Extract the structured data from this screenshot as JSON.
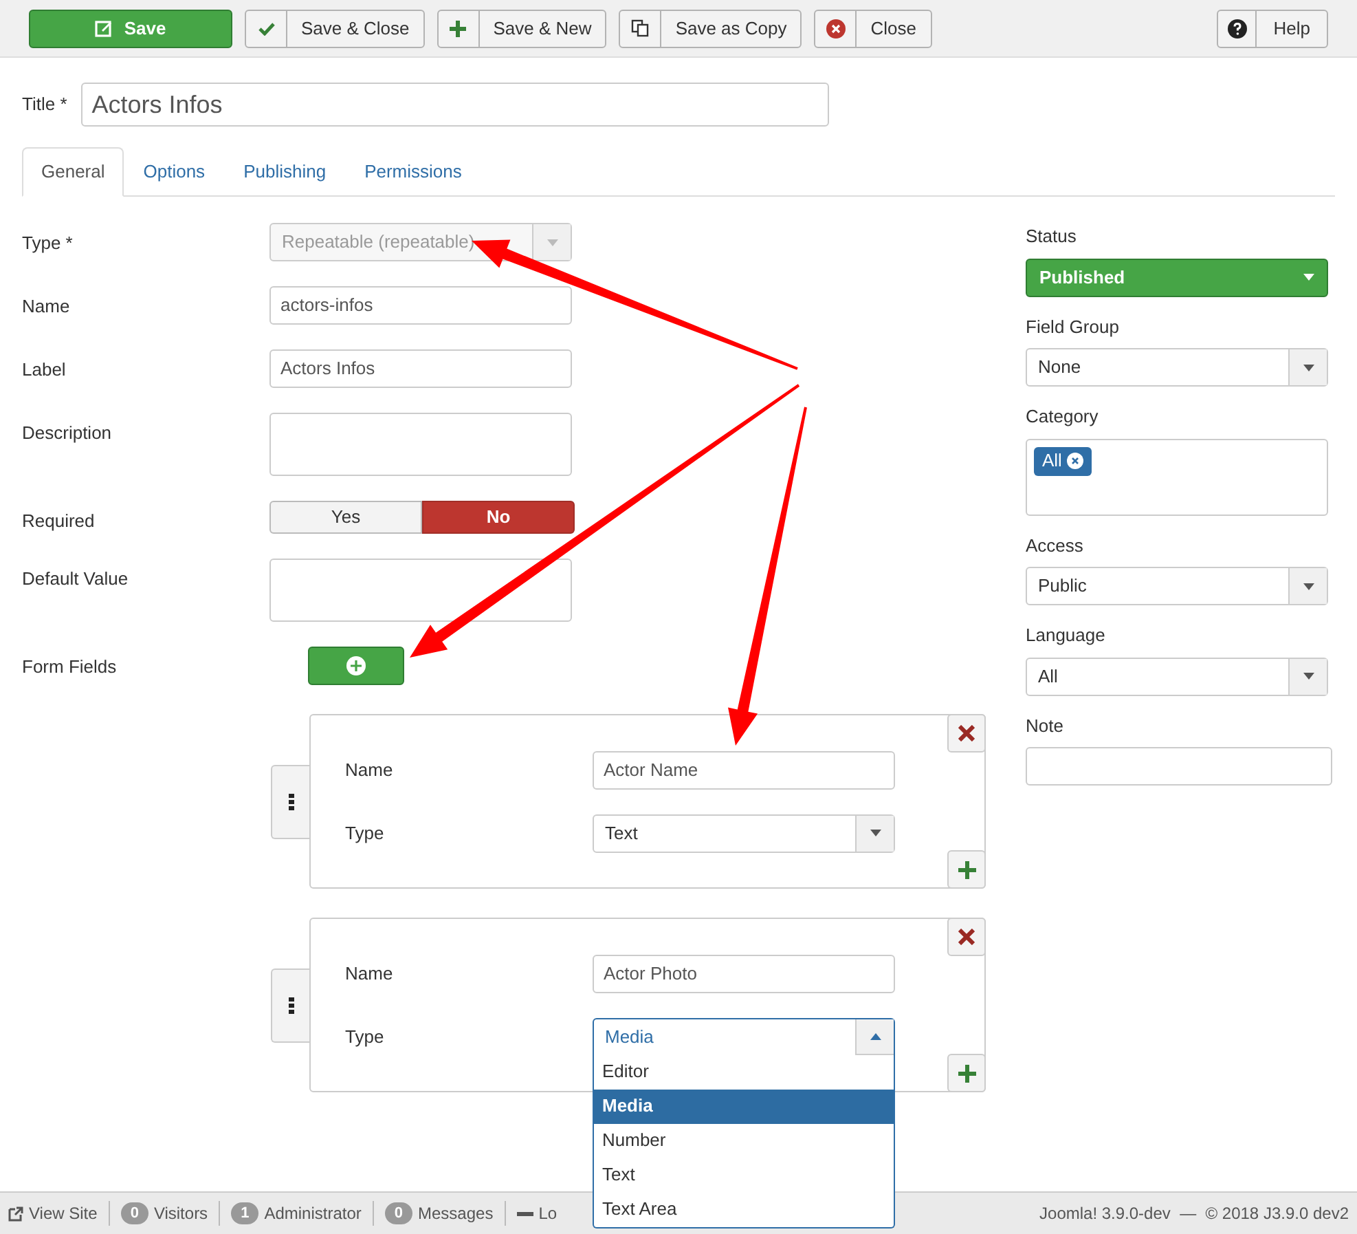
{
  "toolbar": {
    "buttons": [
      {
        "label": "Save",
        "kind": "primary"
      },
      {
        "label": "Save & Close",
        "kind": "default"
      },
      {
        "label": "Save & New",
        "kind": "default"
      },
      {
        "label": "Save as Copy",
        "kind": "default"
      },
      {
        "label": "Close",
        "kind": "default"
      }
    ],
    "help_button": {
      "label": "Help"
    }
  },
  "title": {
    "label": "Title *",
    "value": "Actors Infos"
  },
  "tabs": [
    {
      "label": "General",
      "selected": true
    },
    {
      "label": "Options",
      "selected": false
    },
    {
      "label": "Publishing",
      "selected": false
    },
    {
      "label": "Permissions",
      "selected": false
    }
  ],
  "fields": [
    {
      "kind": "select",
      "label": "Type *",
      "value": "Repeatable (repeatable)",
      "disabled": true
    },
    {
      "kind": "text",
      "label": "Name",
      "value": "actors-infos"
    },
    {
      "kind": "text",
      "label": "Label",
      "value": "Actors Infos"
    },
    {
      "kind": "textarea",
      "label": "Description"
    },
    {
      "kind": "toggle",
      "label": "Required",
      "options": [
        {
          "label": "Yes",
          "selected": false
        },
        {
          "label": "No",
          "selected": true
        }
      ]
    },
    {
      "kind": "textarea",
      "label": "Default Value"
    },
    {
      "kind": "add",
      "label": "Form Fields"
    }
  ],
  "form_rows": [
    {
      "name_label": "Name",
      "name_value": "Actor Name",
      "type_label": "Type",
      "type_value": "Text",
      "expanded": false
    },
    {
      "name_label": "Name",
      "name_value": "Actor Photo",
      "type_label": "Type",
      "type_value": "Media",
      "expanded": true,
      "options": [
        {
          "label": "Editor",
          "selected": false
        },
        {
          "label": "Media",
          "selected": true
        },
        {
          "label": "Number",
          "selected": false
        },
        {
          "label": "Text",
          "selected": false
        },
        {
          "label": "Text Area",
          "selected": false
        }
      ]
    }
  ],
  "sidebar": {
    "status": {
      "label": "Status",
      "value": "Published"
    },
    "fields": [
      {
        "kind": "select",
        "label": "Field Group",
        "value": "None"
      },
      {
        "kind": "tags",
        "label": "Category",
        "tags": [
          "All"
        ]
      },
      {
        "kind": "select",
        "label": "Access",
        "value": "Public"
      },
      {
        "kind": "select",
        "label": "Language",
        "value": "All"
      },
      {
        "kind": "text",
        "label": "Note"
      }
    ]
  },
  "status_bar": {
    "items": [
      {
        "kind": "link",
        "label": "View Site"
      },
      {
        "kind": "count",
        "count": "0",
        "label": "Visitors"
      },
      {
        "kind": "count",
        "count": "1",
        "label": "Administrator"
      },
      {
        "kind": "count",
        "count": "0",
        "label": "Messages"
      },
      {
        "kind": "logout",
        "label": "Lo"
      }
    ],
    "version": "Joomla! 3.9.0-dev  —  © 2018 J3.9.0 dev2"
  }
}
